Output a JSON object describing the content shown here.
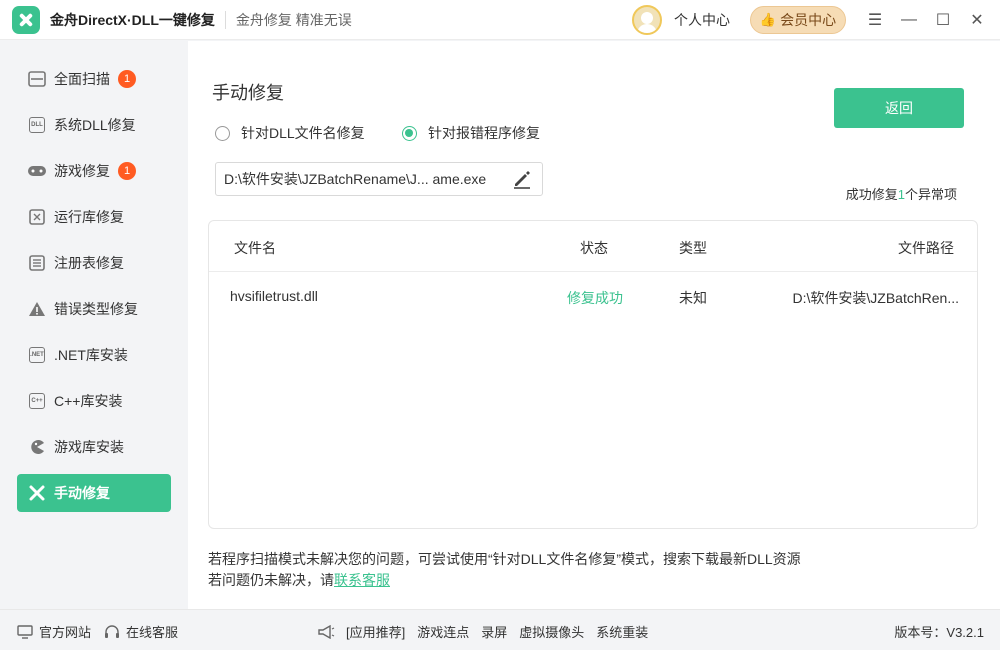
{
  "titlebar": {
    "app_title": "金舟DirectX·DLL一键修复",
    "slogan": "金舟修复 精准无误",
    "user_center": "个人中心",
    "vip_label": "会员中心"
  },
  "sidebar": {
    "items": [
      {
        "label": "全面扫描",
        "badge": "1",
        "icon": "scan-icon"
      },
      {
        "label": "系统DLL修复",
        "icon": "dll-icon"
      },
      {
        "label": "游戏修复",
        "badge": "1",
        "icon": "gamepad-icon"
      },
      {
        "label": "运行库修复",
        "icon": "vs-icon"
      },
      {
        "label": "注册表修复",
        "icon": "list-icon"
      },
      {
        "label": "错误类型修复",
        "icon": "warning-icon"
      },
      {
        "label": ".NET库安装",
        "icon": "net-icon"
      },
      {
        "label": "C++库安装",
        "icon": "cpp-icon"
      },
      {
        "label": "游戏库安装",
        "icon": "pacman-icon"
      },
      {
        "label": "手动修复",
        "icon": "tools-icon",
        "active": true
      }
    ]
  },
  "main": {
    "title": "手动修复",
    "back_label": "返回",
    "radio_dll": "针对DLL文件名修复",
    "radio_program": "针对报错程序修复",
    "path_value": "D:\\软件安装\\JZBatchRename\\J... ame.exe",
    "result_prefix": "成功修复",
    "result_count": "1",
    "result_suffix": "个异常项",
    "table": {
      "headers": {
        "filename": "文件名",
        "status": "状态",
        "type": "类型",
        "path": "文件路径"
      },
      "rows": [
        {
          "filename": "hvsifiletrust.dll",
          "status": "修复成功",
          "type": "未知",
          "path": "D:\\软件安装\\JZBatchRen..."
        }
      ]
    },
    "hint_line1": "若程序扫描模式未解决您的问题，可尝试使用“针对DLL文件名修复”模式，搜索下载最新DLL资源",
    "hint_line2_prefix": "若问题仍未解决，请",
    "hint_link": "联系客服"
  },
  "footer": {
    "website": "官方网站",
    "service": "在线客服",
    "links": [
      "[应用推荐]",
      "游戏连点",
      "录屏",
      "虚拟摄像头",
      "系统重装"
    ],
    "version": "版本号：V3.2.1"
  },
  "colors": {
    "accent": "#3bc28f",
    "badge": "#ff5b22",
    "vip_bg": "#f6dcb5"
  }
}
